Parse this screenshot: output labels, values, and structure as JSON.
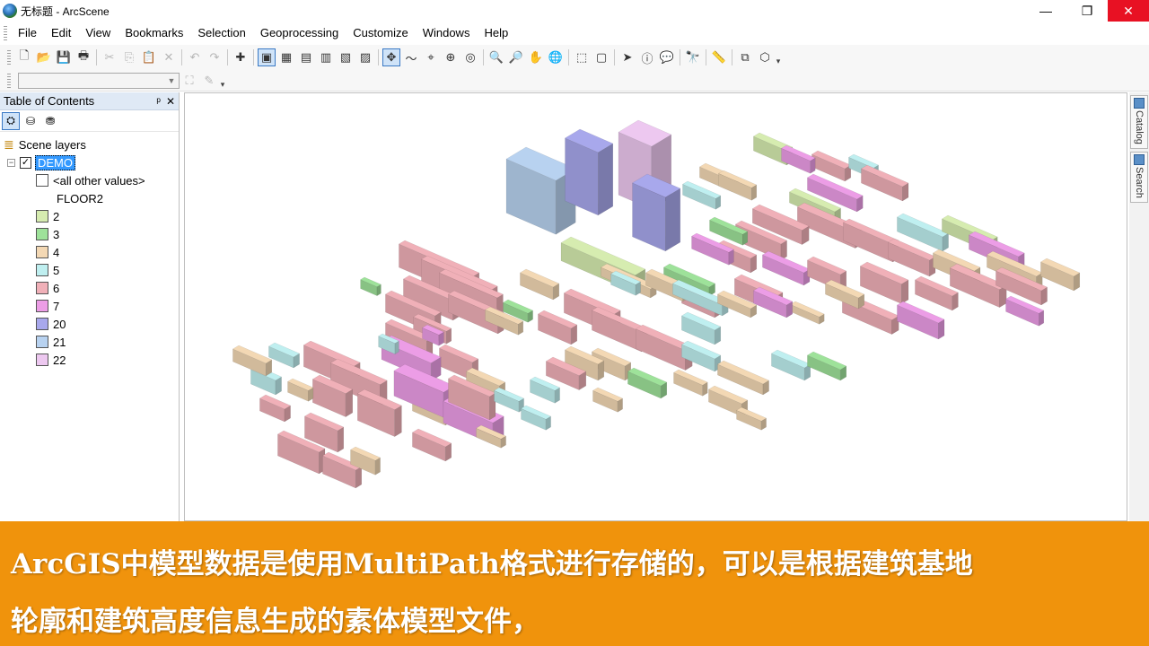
{
  "window": {
    "title": "无标题 - ArcScene",
    "controls": {
      "minimize": "—",
      "maximize": "❐",
      "close": "✕"
    }
  },
  "menu": [
    "File",
    "Edit",
    "View",
    "Bookmarks",
    "Selection",
    "Geoprocessing",
    "Customize",
    "Windows",
    "Help"
  ],
  "toolbar": {
    "buttons": [
      {
        "icon": "new-document-icon",
        "glyph": "🗋"
      },
      {
        "icon": "open-folder-icon",
        "glyph": "📂"
      },
      {
        "icon": "save-icon",
        "glyph": "💾"
      },
      {
        "icon": "print-icon",
        "glyph": "🖶"
      },
      {
        "icon": "cut-icon",
        "glyph": "✂"
      },
      {
        "icon": "copy-icon",
        "glyph": "⎘"
      },
      {
        "icon": "paste-icon",
        "glyph": "📋"
      },
      {
        "icon": "delete-icon",
        "glyph": "✕"
      },
      {
        "icon": "undo-icon",
        "glyph": "↶"
      },
      {
        "icon": "redo-icon",
        "glyph": "↷"
      },
      {
        "icon": "add-data-icon",
        "glyph": "✚"
      },
      {
        "icon": "scene-view-icon",
        "glyph": "▣"
      },
      {
        "icon": "attribute-table-icon",
        "glyph": "▦"
      },
      {
        "icon": "catalog-window-icon",
        "glyph": "▤"
      },
      {
        "icon": "arctoolbox-icon",
        "glyph": "▥"
      },
      {
        "icon": "python-icon",
        "glyph": "▧"
      },
      {
        "icon": "model-builder-icon",
        "glyph": "▨"
      },
      {
        "icon": "navigate-icon",
        "glyph": "✥"
      },
      {
        "icon": "fly-icon",
        "glyph": "〜"
      },
      {
        "icon": "center-target-icon",
        "glyph": "⌖"
      },
      {
        "icon": "zoom-to-target-icon",
        "glyph": "⊕"
      },
      {
        "icon": "set-observer-icon",
        "glyph": "◎"
      },
      {
        "icon": "zoom-in-icon",
        "glyph": "🔍"
      },
      {
        "icon": "zoom-out-icon",
        "glyph": "🔎"
      },
      {
        "icon": "pan-icon",
        "glyph": "✋"
      },
      {
        "icon": "full-extent-icon",
        "glyph": "🌐"
      },
      {
        "icon": "select-features-icon",
        "glyph": "⬚"
      },
      {
        "icon": "clear-selection-icon",
        "glyph": "▢"
      },
      {
        "icon": "select-elements-icon",
        "glyph": "➤"
      },
      {
        "icon": "identify-icon",
        "glyph": "ⓘ"
      },
      {
        "icon": "html-popup-icon",
        "glyph": "💬"
      },
      {
        "icon": "find-icon",
        "glyph": "🔭"
      },
      {
        "icon": "measure-icon",
        "glyph": "📏"
      },
      {
        "icon": "animation-icon",
        "glyph": "⧉"
      },
      {
        "icon": "3d-effects-icon",
        "glyph": "⬡"
      }
    ]
  },
  "toc": {
    "title": "Table of Contents",
    "pin": "ᵖ",
    "close": "✕",
    "group": "Scene layers",
    "layer": "DEMO",
    "other_values": "<all other values>",
    "field": "FLOOR2",
    "classes": [
      {
        "label": "2",
        "color": "#d6ecb0"
      },
      {
        "label": "3",
        "color": "#9ee29a"
      },
      {
        "label": "4",
        "color": "#f3d8b4"
      },
      {
        "label": "5",
        "color": "#bfeff0"
      },
      {
        "label": "6",
        "color": "#f0b0b8"
      },
      {
        "label": "7",
        "color": "#ec9de6"
      },
      {
        "label": "20",
        "color": "#a8a8ec"
      },
      {
        "label": "21",
        "color": "#b8d2f0"
      },
      {
        "label": "22",
        "color": "#edc8f0"
      }
    ]
  },
  "side_tabs": [
    "Catalog",
    "Search"
  ],
  "banner": {
    "line1": "ArcGIS中模型数据是使用MultiPath格式进行存储的，可以是根据建筑基地",
    "line2": "轮廓和建筑高度信息生成的素体模型文件，"
  }
}
